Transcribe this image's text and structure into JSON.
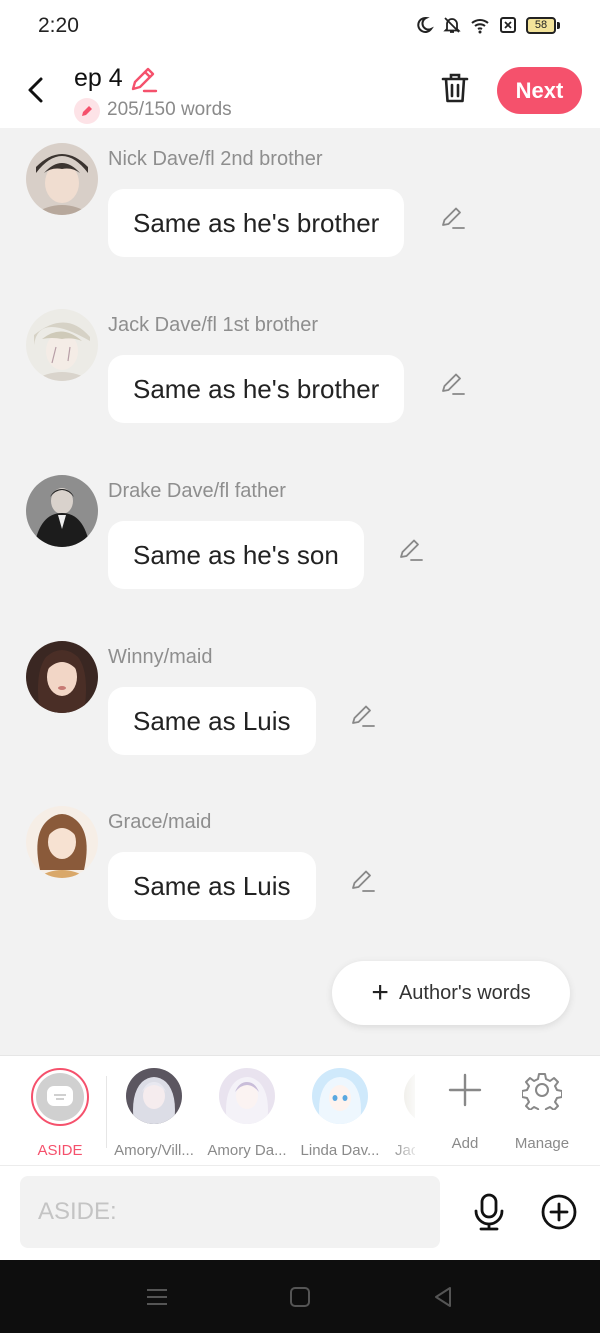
{
  "status_bar": {
    "time": "2:20",
    "battery": "58"
  },
  "header": {
    "title": "ep 4",
    "word_count": "205/150 words",
    "next_label": "Next"
  },
  "messages": [
    {
      "speaker": "Nick Dave/fl 2nd brother",
      "text": "Same as he's brother"
    },
    {
      "speaker": "Jack Dave/fl 1st brother",
      "text": "Same as he's brother"
    },
    {
      "speaker": "Drake Dave/fl father",
      "text": "Same as he's son"
    },
    {
      "speaker": "Winny/maid",
      "text": "Same as Luis"
    },
    {
      "speaker": "Grace/maid",
      "text": "Same as Luis"
    }
  ],
  "author_words_label": "Author's words",
  "characters": {
    "aside_label": "ASIDE",
    "items": [
      {
        "name": "Amory/Vill..."
      },
      {
        "name": "Amory Da..."
      },
      {
        "name": "Linda Dav..."
      },
      {
        "name": "Jac"
      }
    ],
    "add_label": "Add",
    "manage_label": "Manage"
  },
  "input": {
    "placeholder": "ASIDE:"
  },
  "colors": {
    "accent": "#f5516c"
  }
}
